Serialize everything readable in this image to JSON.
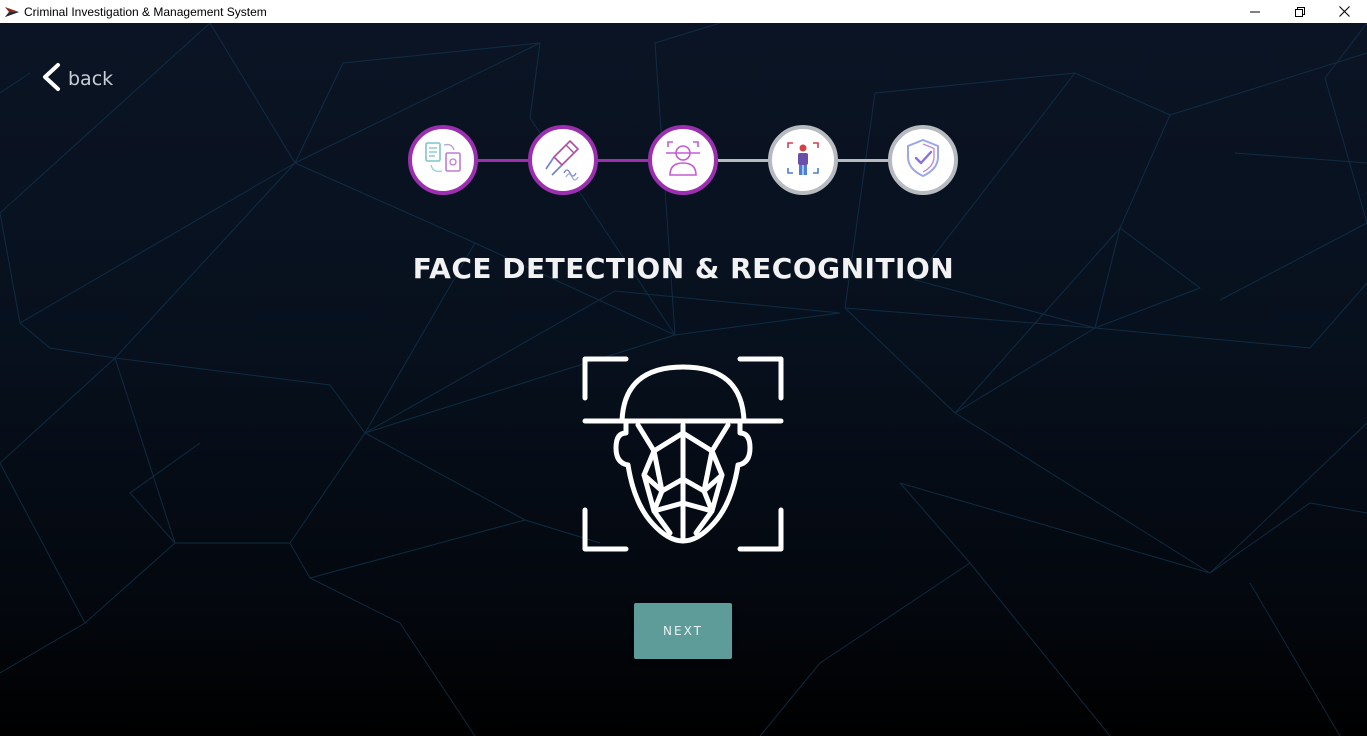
{
  "window": {
    "title": "Criminal Investigation & Management System",
    "controls": [
      "minimize-icon",
      "restore-icon",
      "close-icon"
    ]
  },
  "nav": {
    "back_label": "back",
    "back_icon": "chevron-left-icon"
  },
  "stepper": {
    "current_step": 3,
    "total_steps": 5,
    "steps": [
      {
        "icon": "documents-sync-icon",
        "state": "completed"
      },
      {
        "icon": "fingerprint-dust-brush-icon",
        "state": "completed"
      },
      {
        "icon": "face-scan-person-icon",
        "state": "active"
      },
      {
        "icon": "person-scan-frame-icon",
        "state": "pending"
      },
      {
        "icon": "shield-check-icon",
        "state": "pending"
      }
    ]
  },
  "main": {
    "title": "FACE DETECTION & RECOGNITION",
    "illustration": "face-recognition-icon"
  },
  "actions": {
    "next_label": "NEXT"
  },
  "colors": {
    "accent": "#9c2fb0",
    "inactive": "#b7babf",
    "button": "#5e9c99",
    "background": "#07101d"
  }
}
